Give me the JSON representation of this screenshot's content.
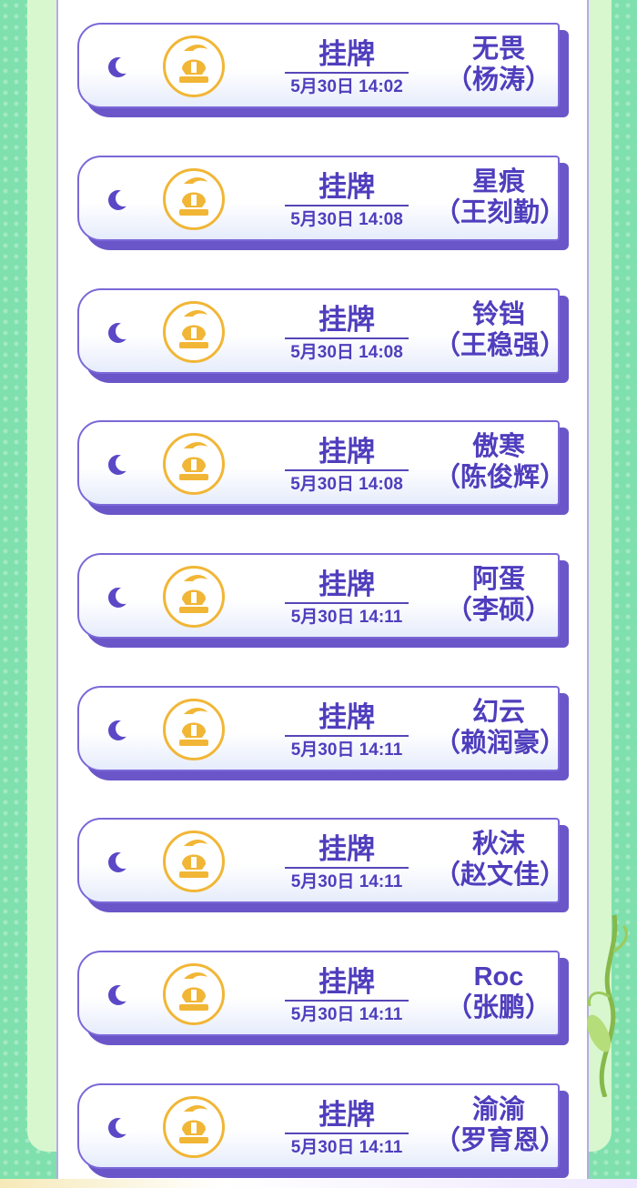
{
  "colors": {
    "background": "#7fe0ad",
    "accent": "#5b48c6",
    "badge": "#f1b636"
  },
  "icons": {
    "status_icon": "crescent-moon-icon",
    "team_badge": "hero-spartan-helmet-logo"
  },
  "cards": [
    {
      "status": "挂牌",
      "time": "5月30日 14:02",
      "nickname": "无畏",
      "real_name": "（杨涛）"
    },
    {
      "status": "挂牌",
      "time": "5月30日 14:08",
      "nickname": "星痕",
      "real_name": "（王刻勤）"
    },
    {
      "status": "挂牌",
      "time": "5月30日 14:08",
      "nickname": "铃铛",
      "real_name": "（王稳强）"
    },
    {
      "status": "挂牌",
      "time": "5月30日 14:08",
      "nickname": "傲寒",
      "real_name": "（陈俊辉）"
    },
    {
      "status": "挂牌",
      "time": "5月30日 14:11",
      "nickname": "阿蛋",
      "real_name": "（李硕）"
    },
    {
      "status": "挂牌",
      "time": "5月30日 14:11",
      "nickname": "幻云",
      "real_name": "（赖润豪）"
    },
    {
      "status": "挂牌",
      "time": "5月30日 14:11",
      "nickname": "秋沫",
      "real_name": "（赵文佳）"
    },
    {
      "status": "挂牌",
      "time": "5月30日 14:11",
      "nickname": "Roc",
      "real_name": "（张鹏）"
    },
    {
      "status": "挂牌",
      "time": "5月30日 14:11",
      "nickname": "渝渝",
      "real_name": "（罗育恩）"
    }
  ]
}
